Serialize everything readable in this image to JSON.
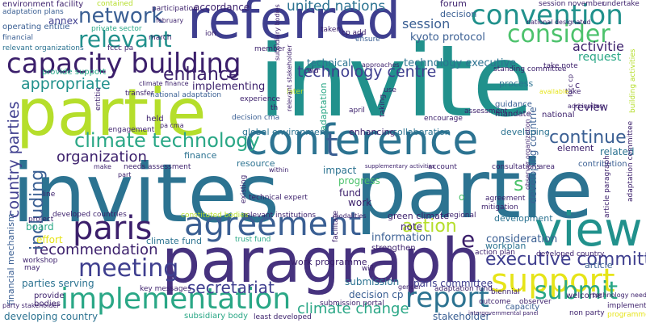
{
  "palette": {
    "navy": "#3b1f6b",
    "indigo": "#3f3f8f",
    "blue": "#3a5f93",
    "teal_blue": "#2c7391",
    "teal": "#21918c",
    "green_teal": "#2aa786",
    "green": "#4cc26c",
    "lime": "#8fd744",
    "yellow_green": "#b5de2b",
    "yellow": "#e6e419",
    "purple": "#46327e"
  },
  "words": [
    "invite",
    "partie",
    "invites",
    "partie",
    "paragraph",
    "referred",
    "conference",
    "view",
    "agreement",
    "paris",
    "implementation",
    "capacity building",
    "convention",
    "consider",
    "network",
    "relevant",
    "support",
    "submit",
    "climate technology",
    "meeting",
    "report",
    "executive committee",
    "recommendation",
    "technology centre",
    "united nations",
    "enhance",
    "appropriate",
    "organization",
    "continue",
    "action",
    "secretariat",
    "including",
    "country parties",
    "climate change",
    "session",
    "request",
    "activitie",
    "kyoto protocol",
    "technology executive",
    "technical",
    "implementing",
    "consideration",
    "information",
    "parties serving",
    "submission",
    "decision cp",
    "paris committee",
    "review",
    "related",
    "note",
    "work",
    "fund",
    "impact",
    "progress",
    "board",
    "effort",
    "s",
    "e",
    "t",
    "developing countrie",
    "developing country",
    "climate fund",
    "green climate",
    "workplan",
    "development",
    "article",
    "stakeholder",
    "forum",
    "decision",
    "accordance",
    "environment facility",
    "adaptation plans",
    "operating entitie",
    "financial",
    "relevant organizations",
    "private sector",
    "participation",
    "contained",
    "annex",
    "global environment",
    "enhancing",
    "collaboration",
    "developing",
    "process",
    "mandate",
    "guidance",
    "national",
    "cp add",
    "taken",
    "ensure",
    "element",
    "contribution",
    "finance",
    "resource",
    "work programme",
    "strengthen",
    "provide support",
    "national adaptation",
    "climate finance",
    "needs assessment",
    "technical expert",
    "relevant institutions",
    "constituted bodies",
    "trust fund",
    "developed countries",
    "submission portal",
    "key messages",
    "subsidiary body",
    "least developed",
    "workshop",
    "provide",
    "bodies",
    "via",
    "welcome",
    "outcome",
    "capacity",
    "observer",
    "implement",
    "programme",
    "technology need",
    "non party",
    "engagement",
    "held",
    "decision cma",
    "experience",
    "encourage",
    "assessment",
    "april",
    "taking",
    "use",
    "th",
    "later",
    "account",
    "consultations",
    "area",
    "supplementary activities",
    "modalities",
    "regional",
    "mitigation",
    "agreement",
    "transfer",
    "adaptation",
    "financial mechanism",
    "party stakeholder",
    "gender",
    "intergovernmental panel",
    "biennial",
    "action plan",
    "developed country",
    "adaptation fund",
    "session november",
    "national designated",
    "standing committee",
    "undertake",
    "take note",
    "add invites",
    "building activities",
    "fccc pa",
    "february",
    "march",
    "ion",
    "member",
    "subsidiary bodies",
    "relevant stakeholder",
    "approaches",
    "observer organization",
    "c",
    "take",
    "available",
    "fccc cp",
    "adaptation committee",
    "article paragraph",
    "line",
    "project",
    "part",
    "make",
    "pa cma",
    "entitie",
    "financial",
    "o",
    "may",
    "will",
    "facilitate",
    "existing",
    "within",
    "climate",
    "engage",
    "accord",
    "contribute",
    "within"
  ]
}
